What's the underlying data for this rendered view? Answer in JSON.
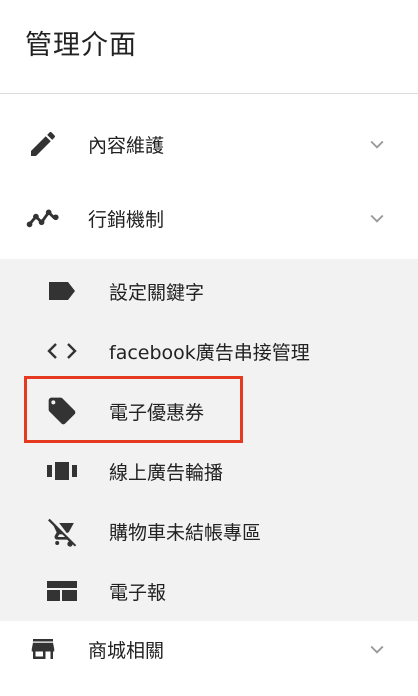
{
  "header": {
    "title": "管理介面"
  },
  "menu": {
    "items": [
      {
        "label": "內容維護",
        "icon": "pencil-icon",
        "expanded": false
      },
      {
        "label": "行銷機制",
        "icon": "trending-line-icon",
        "expanded": true
      },
      {
        "label": "商城相關",
        "icon": "store-icon",
        "expanded": false
      }
    ],
    "marketing_sub": [
      {
        "label": "設定關鍵字",
        "icon": "label-icon"
      },
      {
        "label": "facebook廣告串接管理",
        "icon": "code-icon"
      },
      {
        "label": "電子優惠券",
        "icon": "tag-icon",
        "highlighted": true
      },
      {
        "label": "線上廣告輪播",
        "icon": "carousel-icon"
      },
      {
        "label": "購物車未結帳專區",
        "icon": "remove-cart-icon"
      },
      {
        "label": "電子報",
        "icon": "newsletter-icon"
      }
    ]
  },
  "colors": {
    "icon": "#333333",
    "chevron": "#999999",
    "submenu_bg": "#f2f2f2",
    "highlight": "#e53a20",
    "divider": "#dddddd"
  }
}
